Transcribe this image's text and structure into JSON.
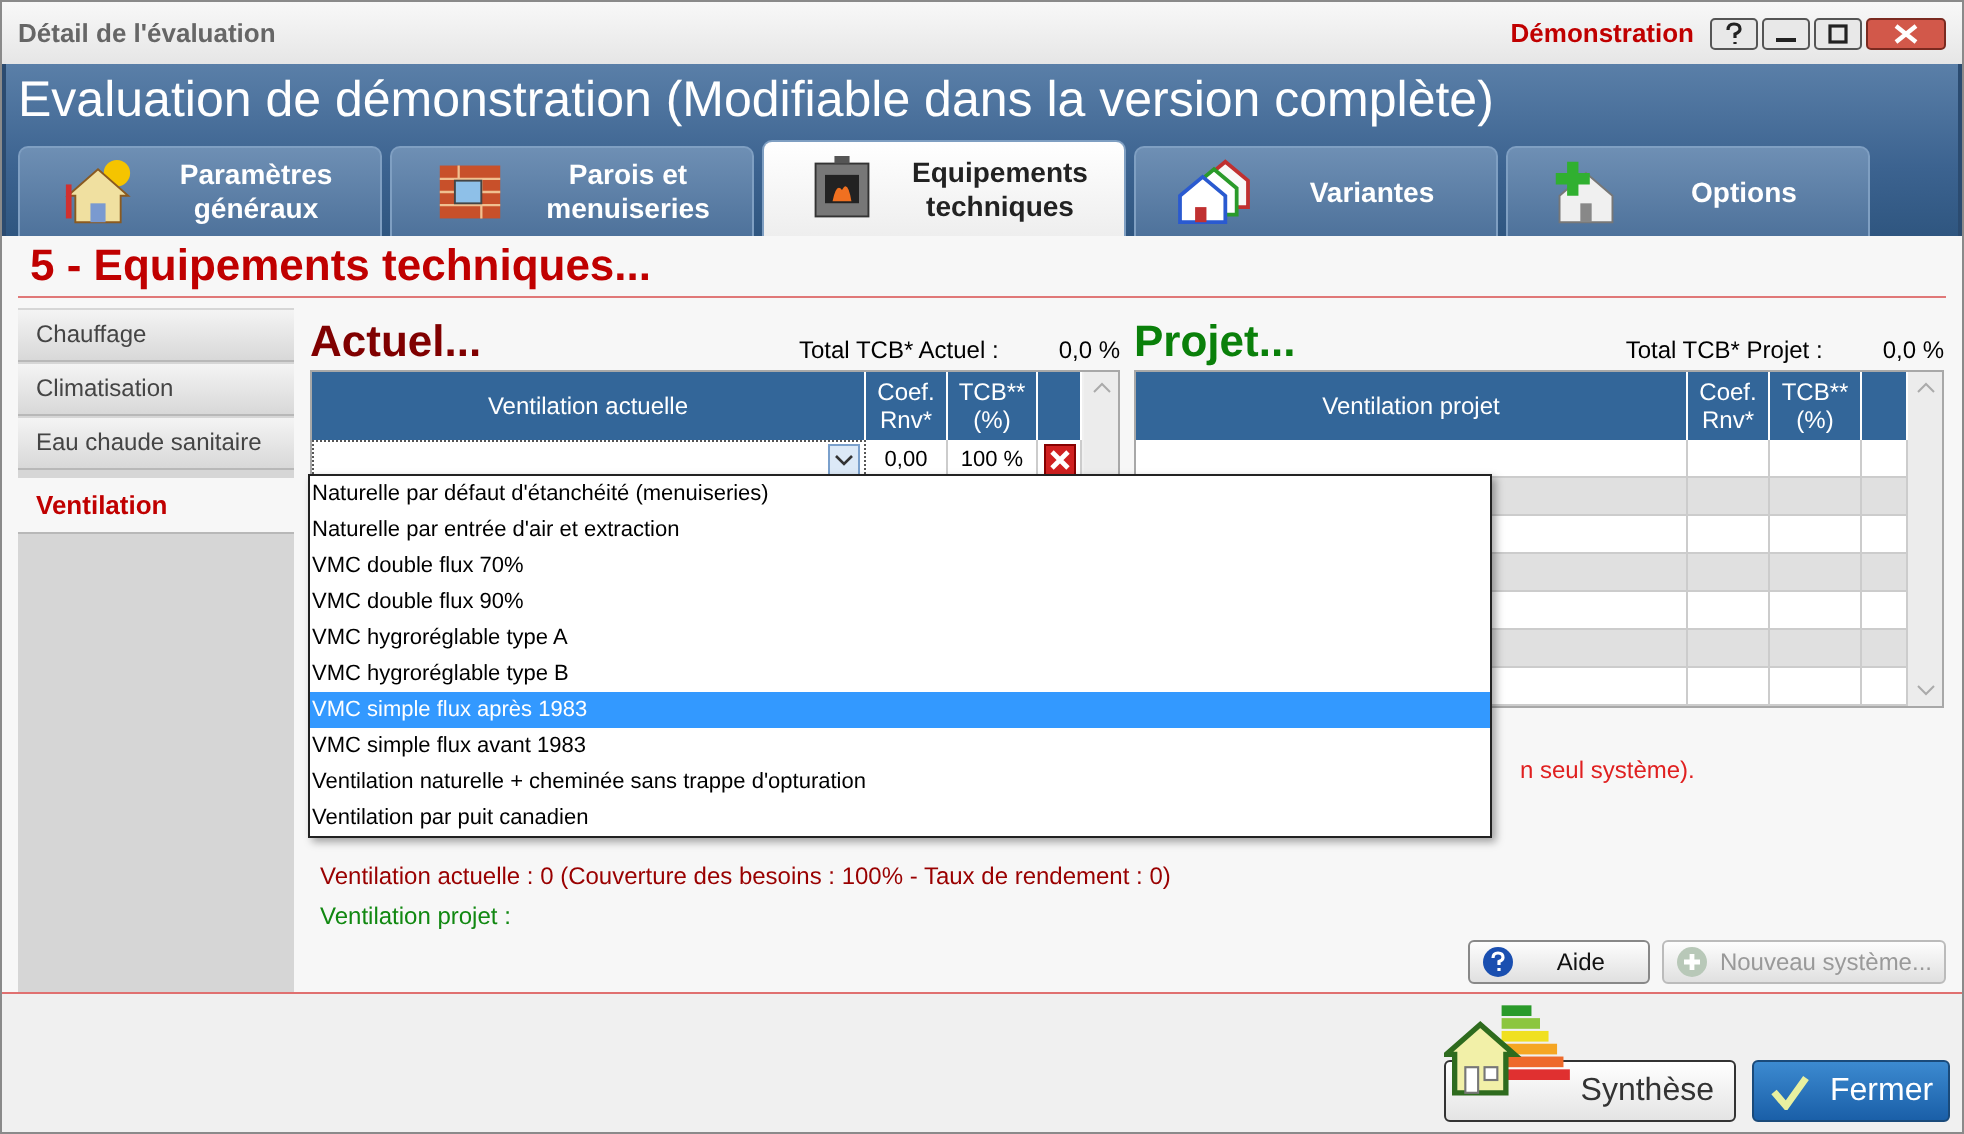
{
  "window": {
    "title": "Détail de l'évaluation",
    "badge": "Démonstration"
  },
  "header": {
    "title": "Evaluation de démonstration (Modifiable dans la version complète)"
  },
  "tabs": [
    {
      "label": "Paramètres généraux",
      "selected": false
    },
    {
      "label": "Parois et menuiseries",
      "selected": false
    },
    {
      "label": "Equipements techniques",
      "selected": true
    },
    {
      "label": "Variantes",
      "selected": false
    },
    {
      "label": "Options",
      "selected": false
    }
  ],
  "section_title": "5 - Equipements techniques...",
  "sidebar": {
    "items": [
      {
        "label": "Chauffage",
        "selected": false
      },
      {
        "label": "Climatisation",
        "selected": false
      },
      {
        "label": "Eau chaude sanitaire",
        "selected": false
      },
      {
        "label": "Ventilation",
        "selected": true
      }
    ]
  },
  "current": {
    "title": "Actuel...",
    "total_label": "Total TCB* Actuel :",
    "total_value": "0,0 %",
    "table": {
      "columns": [
        "Ventilation actuelle",
        "Coef. Rnv*",
        "TCB** (%)"
      ],
      "rows": [
        {
          "system": "",
          "coef": "0,00",
          "tcb": "100 %"
        }
      ]
    },
    "dropdown": {
      "items": [
        {
          "label": "Naturelle par défaut d'étanchéité (menuiseries)",
          "selected": false
        },
        {
          "label": "Naturelle par entrée d'air et extraction",
          "selected": false
        },
        {
          "label": "VMC double flux 70%",
          "selected": false
        },
        {
          "label": "VMC double flux 90%",
          "selected": false
        },
        {
          "label": "VMC hygroréglable type A",
          "selected": false
        },
        {
          "label": "VMC hygroréglable type B",
          "selected": false
        },
        {
          "label": "VMC simple flux après 1983",
          "selected": true
        },
        {
          "label": "VMC simple flux avant 1983",
          "selected": false
        },
        {
          "label": "Ventilation naturelle + cheminée sans trappe d'opturation",
          "selected": false
        },
        {
          "label": "Ventilation par puit canadien",
          "selected": false
        }
      ]
    }
  },
  "project": {
    "title": "Projet...",
    "total_label": "Total TCB* Projet :",
    "total_value": "0,0 %",
    "table": {
      "columns": [
        "Ventilation projet",
        "Coef. Rnv*",
        "TCB** (%)"
      ]
    }
  },
  "note": "n seul système).",
  "summary": [
    {
      "kind": "current",
      "text": "Ventilation actuelle : 0 (Couverture des besoins : 100% - Taux de rendement : 0)"
    },
    {
      "kind": "project",
      "text": "Ventilation projet :"
    }
  ],
  "buttons": [
    {
      "label": "Aide",
      "disabled": false
    },
    {
      "label": "Nouveau système...",
      "disabled": true
    }
  ],
  "footer_buttons": [
    {
      "label": "Synthèse"
    },
    {
      "label": "Fermer"
    }
  ]
}
